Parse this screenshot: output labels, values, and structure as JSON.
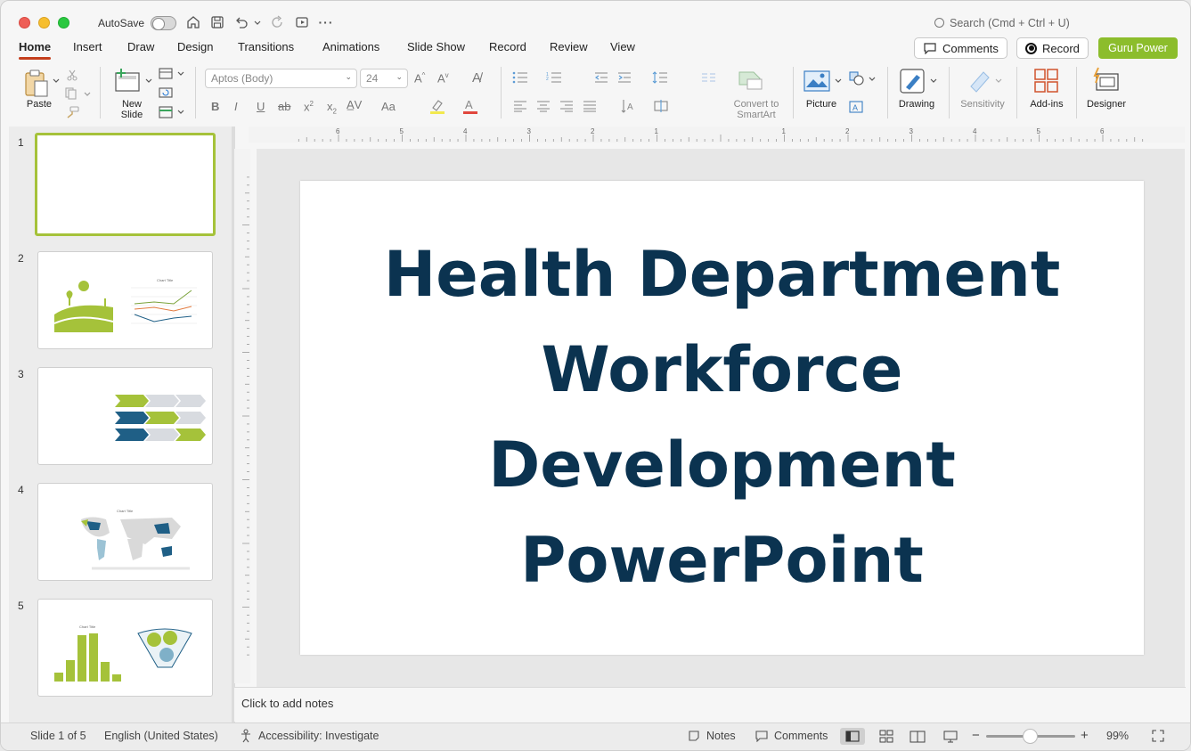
{
  "titlebar": {
    "autosave_label": "AutoSave",
    "search_placeholder": "Search (Cmd + Ctrl + U)"
  },
  "tabs": [
    {
      "label": "Home",
      "active": true
    },
    {
      "label": "Insert"
    },
    {
      "label": "Draw"
    },
    {
      "label": "Design"
    },
    {
      "label": "Transitions"
    },
    {
      "label": "Animations"
    },
    {
      "label": "Slide Show"
    },
    {
      "label": "Record"
    },
    {
      "label": "Review"
    },
    {
      "label": "View"
    }
  ],
  "header_buttons": {
    "comments": "Comments",
    "record": "Record",
    "guru": "Guru Power"
  },
  "ribbon": {
    "paste": "Paste",
    "new_slide": "New\nSlide",
    "font_name": "Aptos (Body)",
    "font_size": "24",
    "convert_smartart": "Convert to\nSmartArt",
    "picture": "Picture",
    "drawing": "Drawing",
    "sensitivity": "Sensitivity",
    "addins": "Add-ins",
    "designer": "Designer"
  },
  "thumbnails": [
    {
      "num": "1",
      "selected": true
    },
    {
      "num": "2"
    },
    {
      "num": "3"
    },
    {
      "num": "4"
    },
    {
      "num": "5"
    }
  ],
  "slide": {
    "title": "Health Department Workforce Development PowerPoint"
  },
  "notes": {
    "placeholder": "Click to add notes"
  },
  "status": {
    "slide_info": "Slide 1 of 5",
    "language": "English (United States)",
    "accessibility": "Accessibility: Investigate",
    "notes": "Notes",
    "comments": "Comments",
    "zoom": "99%"
  },
  "colors": {
    "accent_tab": "#c43e1c",
    "guru_green": "#8cbd2c",
    "title_navy": "#0b3350",
    "thumb_green": "#a5c23a",
    "thumb_blue": "#1f5f86"
  }
}
